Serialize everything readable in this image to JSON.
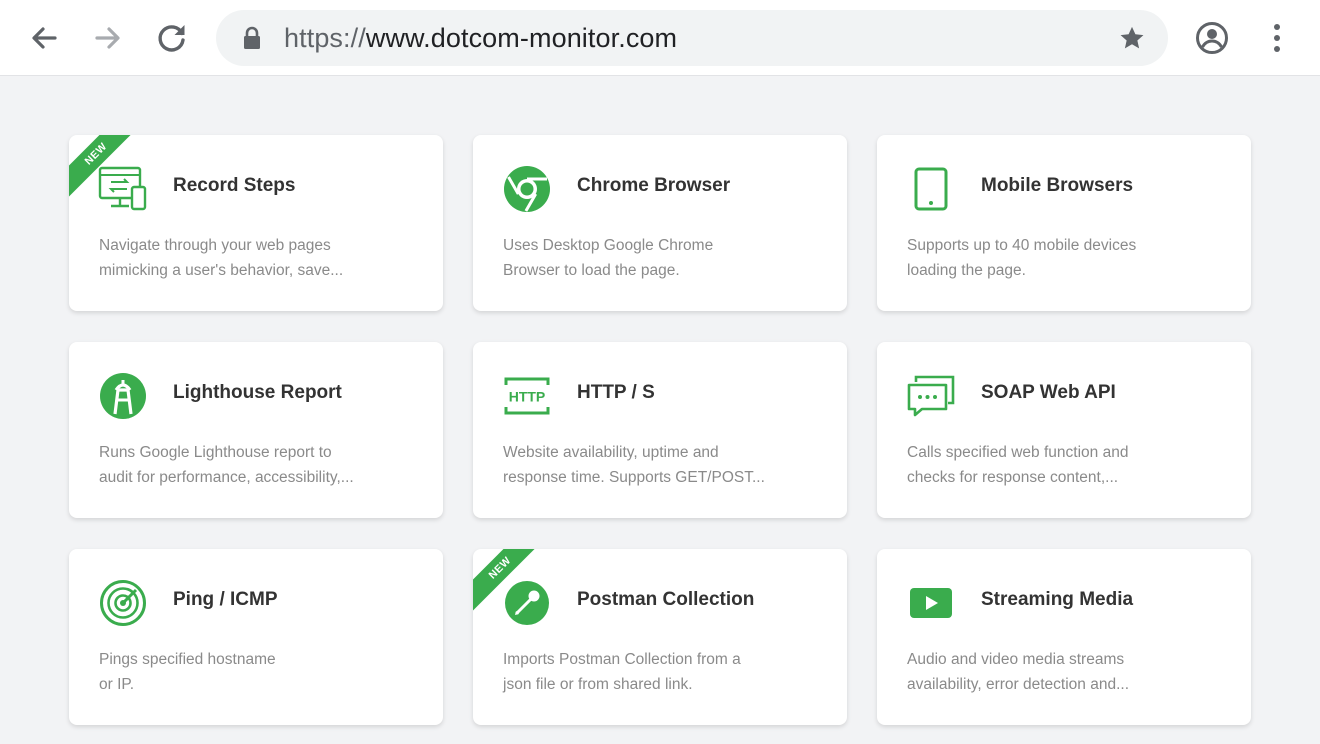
{
  "browser": {
    "url_scheme": "https://",
    "url_host": "www.dotcom-monitor.com"
  },
  "colors": {
    "accent_green": "#3aac4d",
    "icon_gray": "#5f6368"
  },
  "cards": [
    {
      "title": "Record Steps",
      "desc_line1": "Navigate through your web pages",
      "desc_line2": "mimicking a user's behavior, save...",
      "badge": "NEW",
      "icon": "record-steps-icon"
    },
    {
      "title": "Chrome Browser",
      "desc_line1": "Uses Desktop Google Chrome",
      "desc_line2": "Browser to load the page.",
      "icon": "chrome-icon"
    },
    {
      "title": "Mobile Browsers",
      "desc_line1": "Supports up to 40 mobile devices",
      "desc_line2": "loading the page.",
      "icon": "mobile-device-icon"
    },
    {
      "title": "Lighthouse Report",
      "desc_line1": "Runs Google Lighthouse report to",
      "desc_line2": "audit for performance, accessibility,...",
      "icon": "lighthouse-icon"
    },
    {
      "title": "HTTP / S",
      "desc_line1": "Website availability, uptime and",
      "desc_line2": "response time. Supports GET/POST...",
      "icon": "http-icon"
    },
    {
      "title": "SOAP Web API",
      "desc_line1": "Calls specified web function and",
      "desc_line2": "checks for response content,...",
      "icon": "soap-api-icon"
    },
    {
      "title": "Ping / ICMP",
      "desc_line1": "Pings specified hostname",
      "desc_line2": "or IP.",
      "icon": "ping-radar-icon"
    },
    {
      "title": "Postman Collection",
      "desc_line1": "Imports Postman Collection from a",
      "desc_line2": "json file or from shared link.",
      "badge": "NEW",
      "icon": "postman-icon"
    },
    {
      "title": "Streaming Media",
      "desc_line1": "Audio and video media streams",
      "desc_line2": "availability, error detection and...",
      "icon": "play-video-icon"
    }
  ]
}
